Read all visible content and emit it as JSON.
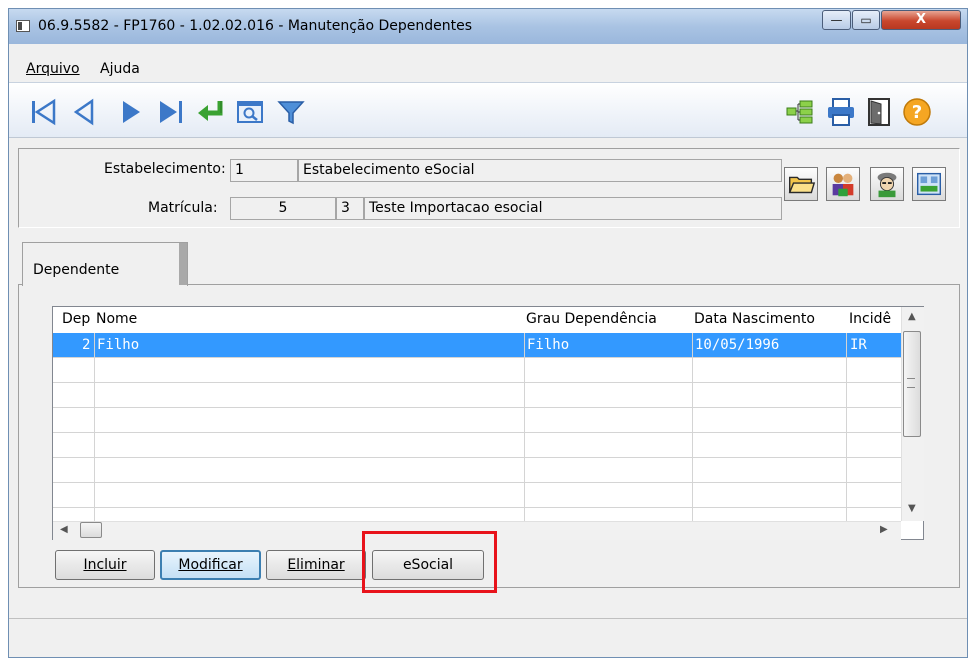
{
  "window": {
    "title": "06.9.5582 - FP1760 - 1.02.02.016 - Manutenção Dependentes",
    "min_glyph": "—",
    "max_glyph": "▭",
    "close_glyph": "X"
  },
  "menu": {
    "items": [
      "Arquivo",
      "Ajuda"
    ]
  },
  "header": {
    "estabelecimento_label": "Estabelecimento:",
    "estabelecimento_code": "1",
    "estabelecimento_name": "Estabelecimento eSocial",
    "matricula_label": "Matrícula:",
    "matricula_value": "5",
    "matricula_digit": "3",
    "matricula_name": "Teste Importacao esocial"
  },
  "tabs": [
    {
      "label": "Dependente",
      "active": true
    }
  ],
  "grid": {
    "columns": [
      "Dep",
      "Nome",
      "Grau Dependência",
      "Data Nascimento",
      "Incidên"
    ],
    "rows": [
      {
        "dep": "2",
        "nome": "Filho",
        "grau": "Filho",
        "data": "10/05/1996",
        "incidencia": "IR",
        "selected": true
      }
    ]
  },
  "buttons": {
    "incluir": "Incluir",
    "modificar": "Modificar",
    "eliminar": "Eliminar",
    "esocial": "eSocial"
  },
  "colors": {
    "selection": "#3399ff",
    "highlight": "#e8131b",
    "titlebar": "#a9c3e3"
  },
  "icons": {
    "toolbar_left": [
      "first-record-icon",
      "previous-record-icon",
      "next-record-icon",
      "last-record-icon",
      "goto-icon",
      "search-icon",
      "filter-icon"
    ],
    "toolbar_right": [
      "tree-icon",
      "print-icon",
      "exit-icon",
      "help-icon"
    ],
    "header_right": [
      "folder-icon",
      "people-icon",
      "person-icon",
      "film-icon"
    ]
  }
}
